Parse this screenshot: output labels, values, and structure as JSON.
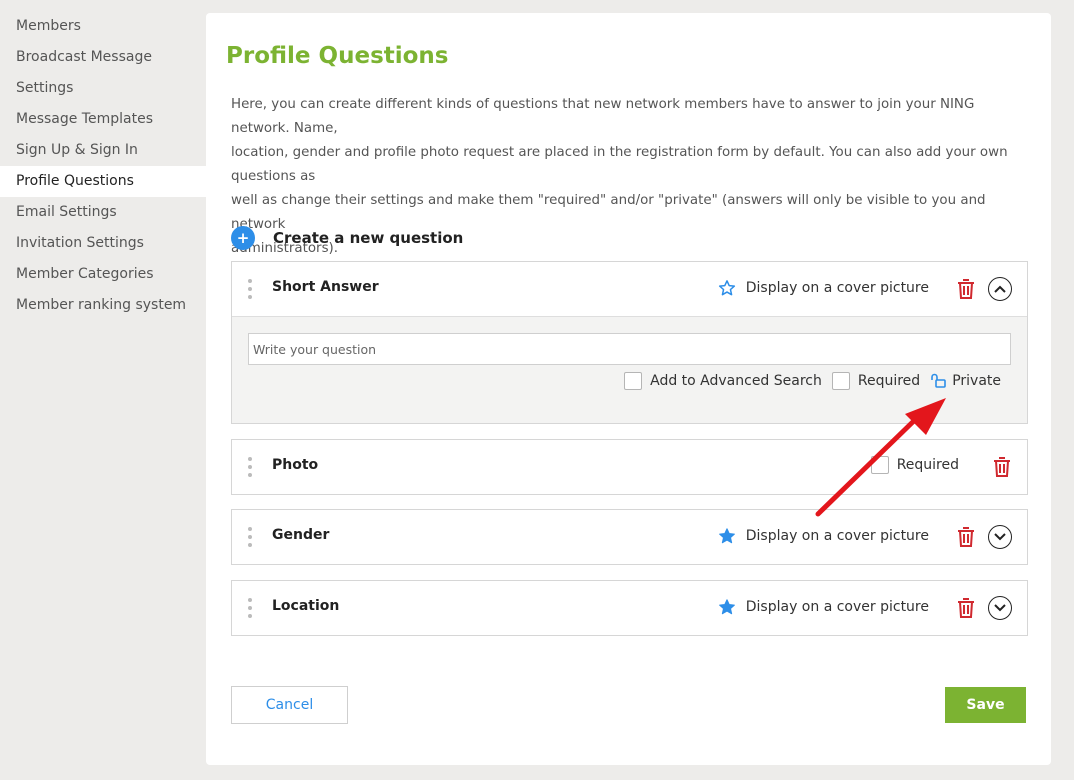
{
  "sidebar": {
    "items": [
      {
        "label": "Members"
      },
      {
        "label": "Broadcast Message"
      },
      {
        "label": "Settings"
      },
      {
        "label": "Message Templates"
      },
      {
        "label": "Sign Up & Sign In"
      },
      {
        "label": "Profile Questions",
        "active": true
      },
      {
        "label": "Email Settings"
      },
      {
        "label": "Invitation Settings"
      },
      {
        "label": "Member Categories"
      },
      {
        "label": "Member ranking system"
      }
    ]
  },
  "main": {
    "title": "Profile Questions",
    "intro_lines": [
      "Here, you can create different kinds of questions that new network members have to answer to join your NING network. Name,",
      "location, gender and profile photo request are placed in the registration form by default. You can also add your own questions as",
      "well as change their settings and make them \"required\" and/or \"private\" (answers will only be visible to you and network",
      "administrators)."
    ],
    "create_label": "Create a new question",
    "questions": [
      {
        "title": "Short Answer",
        "cover_label": "Display on a cover picture",
        "expanded": true,
        "input_placeholder": "Write your question",
        "options": {
          "advanced_search": "Add to Advanced Search",
          "required": "Required",
          "private": "Private"
        }
      },
      {
        "title": "Photo",
        "required_label": "Required"
      },
      {
        "title": "Gender",
        "cover_label": "Display on a cover picture"
      },
      {
        "title": "Location",
        "cover_label": "Display on a cover picture"
      }
    ],
    "cancel_label": "Cancel",
    "save_label": "Save"
  },
  "colors": {
    "accent_green": "#7cb332",
    "link_blue": "#2d8ee8",
    "danger_red": "#d0292f",
    "annotation_red": "#e3161c"
  },
  "icons": [
    "plus-icon",
    "drag-handle-icon",
    "star-outline-icon",
    "star-filled-icon",
    "trash-icon",
    "chevron-up-icon",
    "chevron-down-icon",
    "lock-open-icon",
    "arrow-annotation"
  ]
}
